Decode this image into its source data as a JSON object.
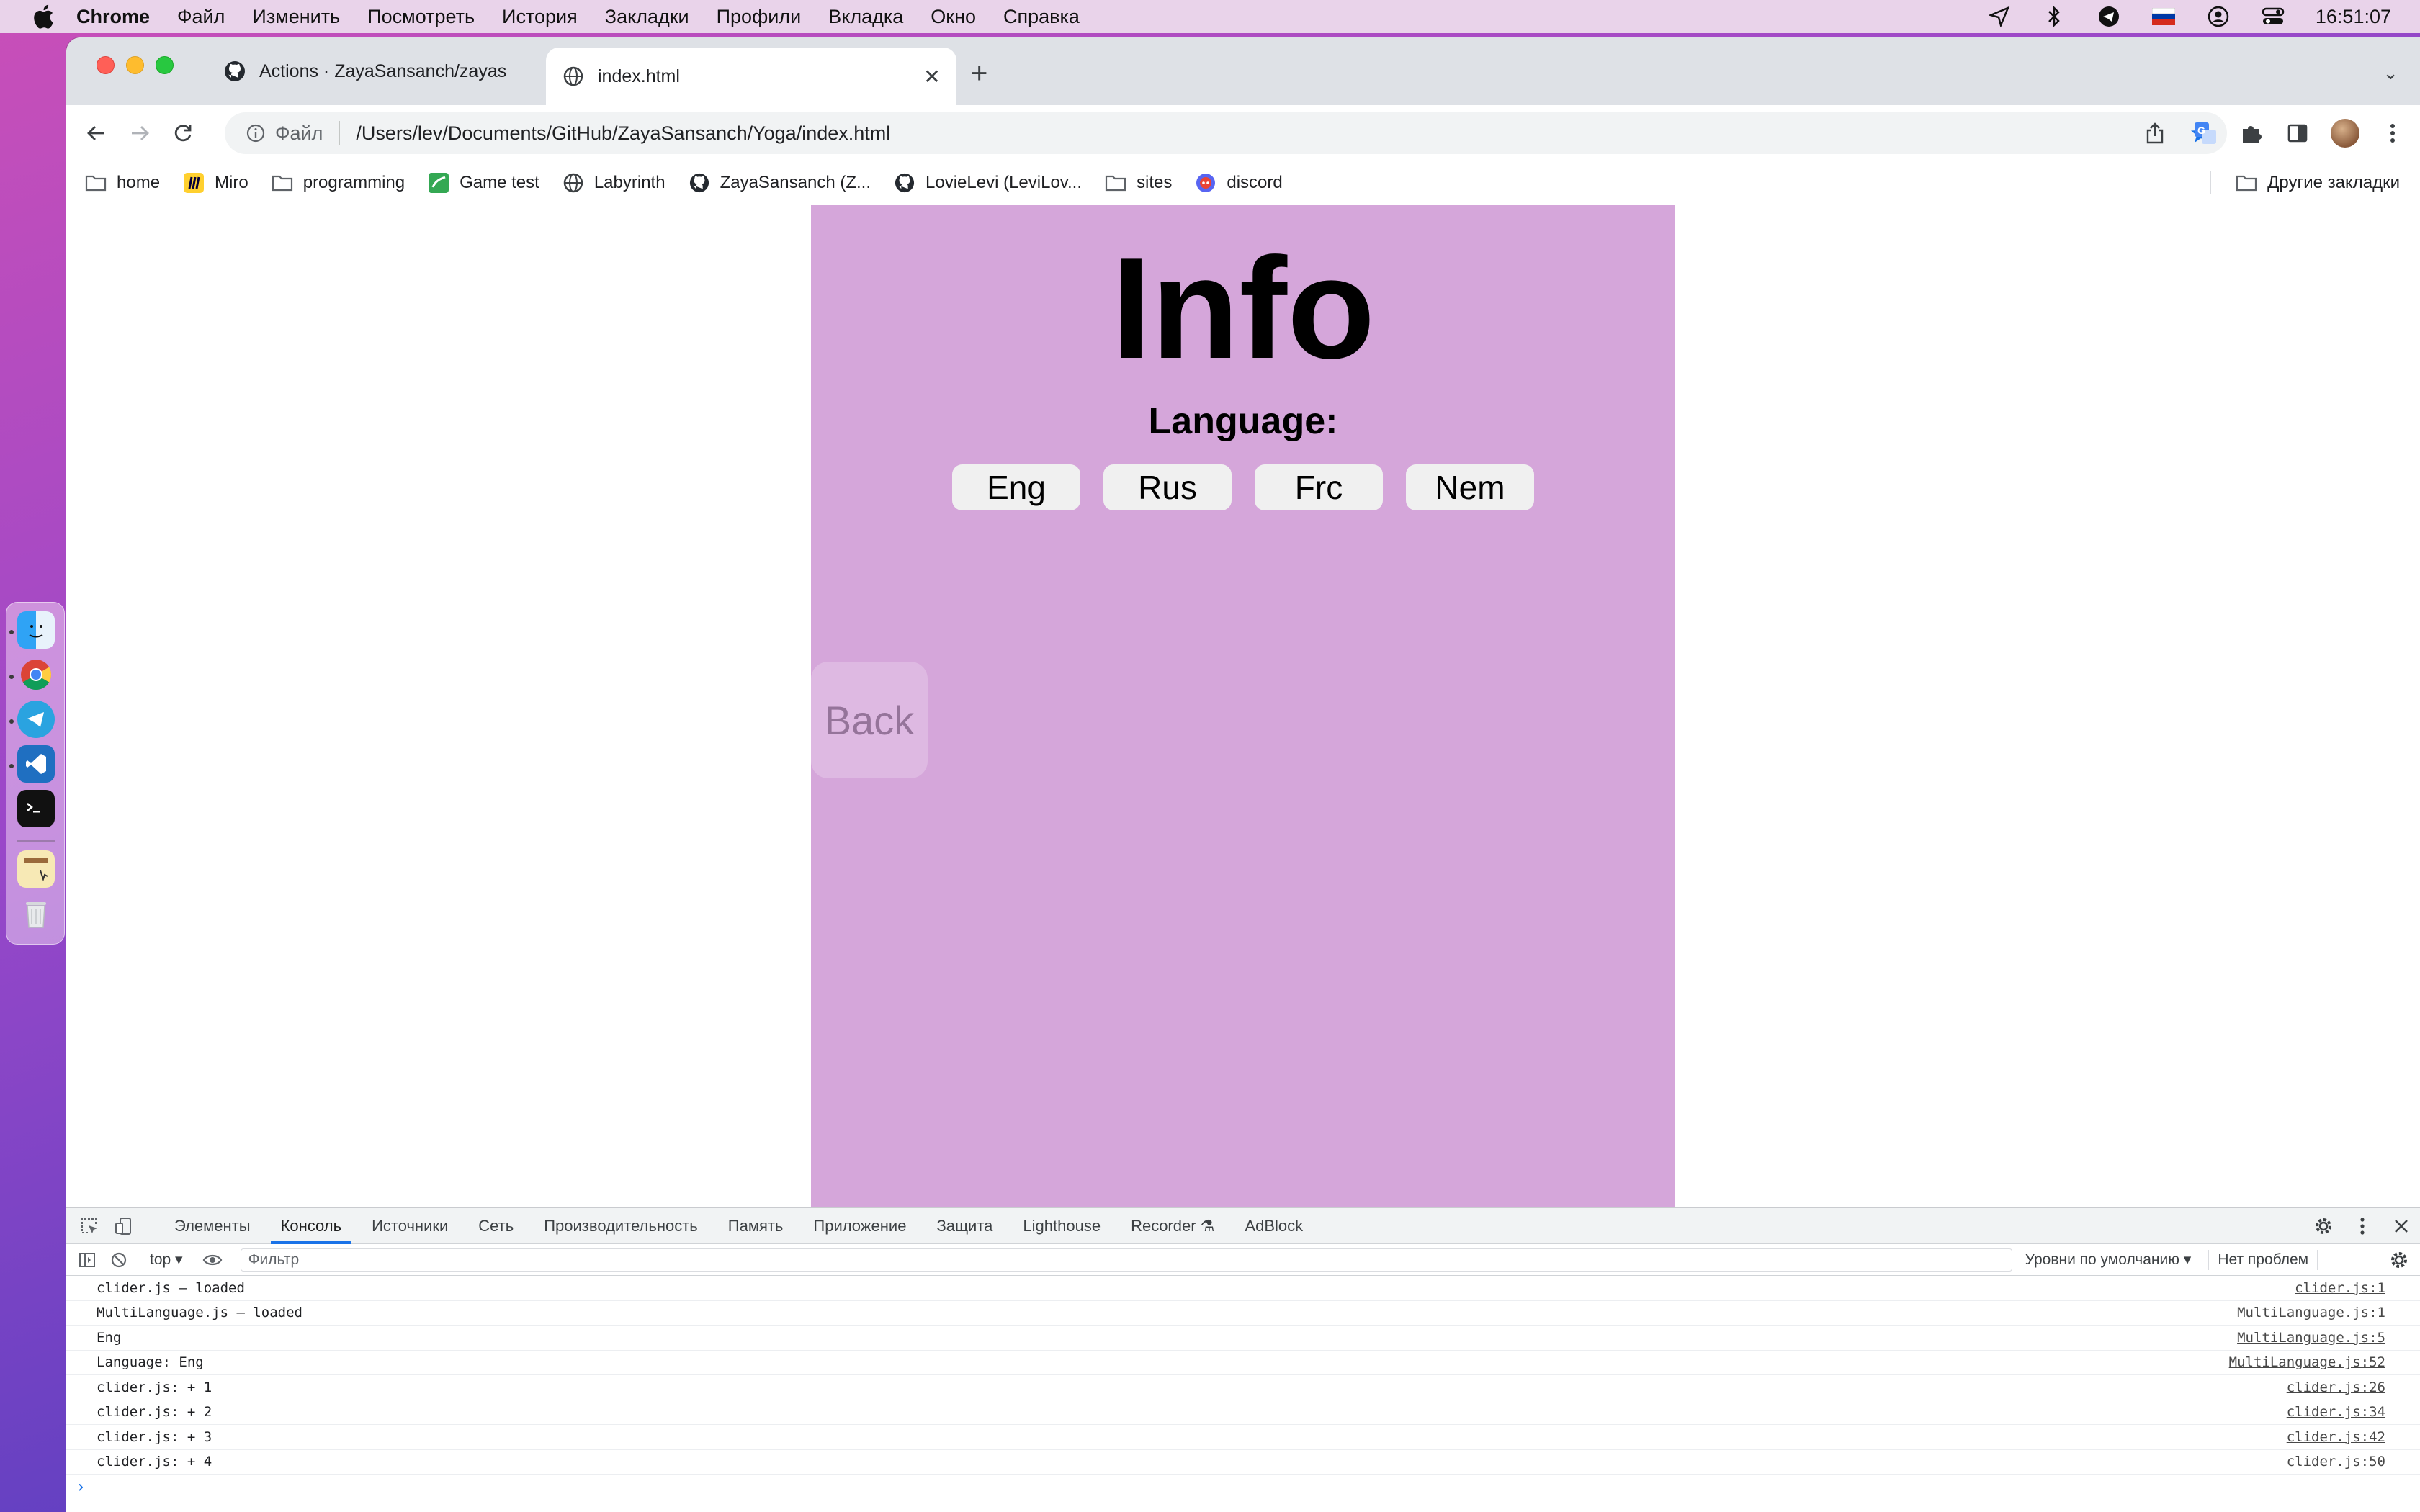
{
  "menubar": {
    "app_name": "Chrome",
    "items": [
      "Файл",
      "Изменить",
      "Посмотреть",
      "История",
      "Закладки",
      "Профили",
      "Вкладка",
      "Окно",
      "Справка"
    ],
    "clock": "16:51:07"
  },
  "tabs": [
    {
      "title": "Actions · ZayaSansanch/zayas",
      "icon": "github-icon",
      "active": false
    },
    {
      "title": "index.html",
      "icon": "globe-icon",
      "active": true
    }
  ],
  "omnibox": {
    "scheme_label": "Файл",
    "url": "/Users/lev/Documents/GitHub/ZayaSansanch/Yoga/index.html"
  },
  "bookmarks": [
    {
      "label": "home",
      "icon": "folder-icon"
    },
    {
      "label": "Miro",
      "icon": "miro-icon"
    },
    {
      "label": "programming",
      "icon": "folder-icon"
    },
    {
      "label": "Game test",
      "icon": "game-icon"
    },
    {
      "label": "Labyrinth",
      "icon": "globe-icon"
    },
    {
      "label": "ZayaSansanch (Z...",
      "icon": "github-icon"
    },
    {
      "label": "LovieLevi (LeviLov...",
      "icon": "github-icon"
    },
    {
      "label": "sites",
      "icon": "folder-icon"
    },
    {
      "label": "discord",
      "icon": "discord-icon"
    }
  ],
  "other_bookmarks": "Другие закладки",
  "page": {
    "heading": "Info",
    "language_label": "Language:",
    "language_buttons": [
      "Eng",
      "Rus",
      "Frc",
      "Nem"
    ],
    "back_label": "Back",
    "panel_color": "#d5a6da"
  },
  "devtools": {
    "tabs": [
      "Элементы",
      "Консоль",
      "Источники",
      "Сеть",
      "Производительность",
      "Память",
      "Приложение",
      "Защита",
      "Lighthouse",
      "Recorder ⚗",
      "AdBlock"
    ],
    "active_tab": "Консоль",
    "context": "top ▾",
    "filter_placeholder": "Фильтр",
    "levels": "Уровни по умолчанию ▾",
    "issues": "Нет проблем",
    "logs": [
      {
        "message": "clider.js – loaded",
        "source": "clider.js:1"
      },
      {
        "message": "MultiLanguage.js – loaded",
        "source": "MultiLanguage.js:1"
      },
      {
        "message": "Eng",
        "source": "MultiLanguage.js:5"
      },
      {
        "message": "Language: Eng",
        "source": "MultiLanguage.js:52"
      },
      {
        "message": "clider.js: + 1",
        "source": "clider.js:26"
      },
      {
        "message": "clider.js: + 2",
        "source": "clider.js:34"
      },
      {
        "message": "clider.js: + 3",
        "source": "clider.js:42"
      },
      {
        "message": "clider.js: + 4",
        "source": "clider.js:50"
      }
    ],
    "prompt": "›"
  }
}
